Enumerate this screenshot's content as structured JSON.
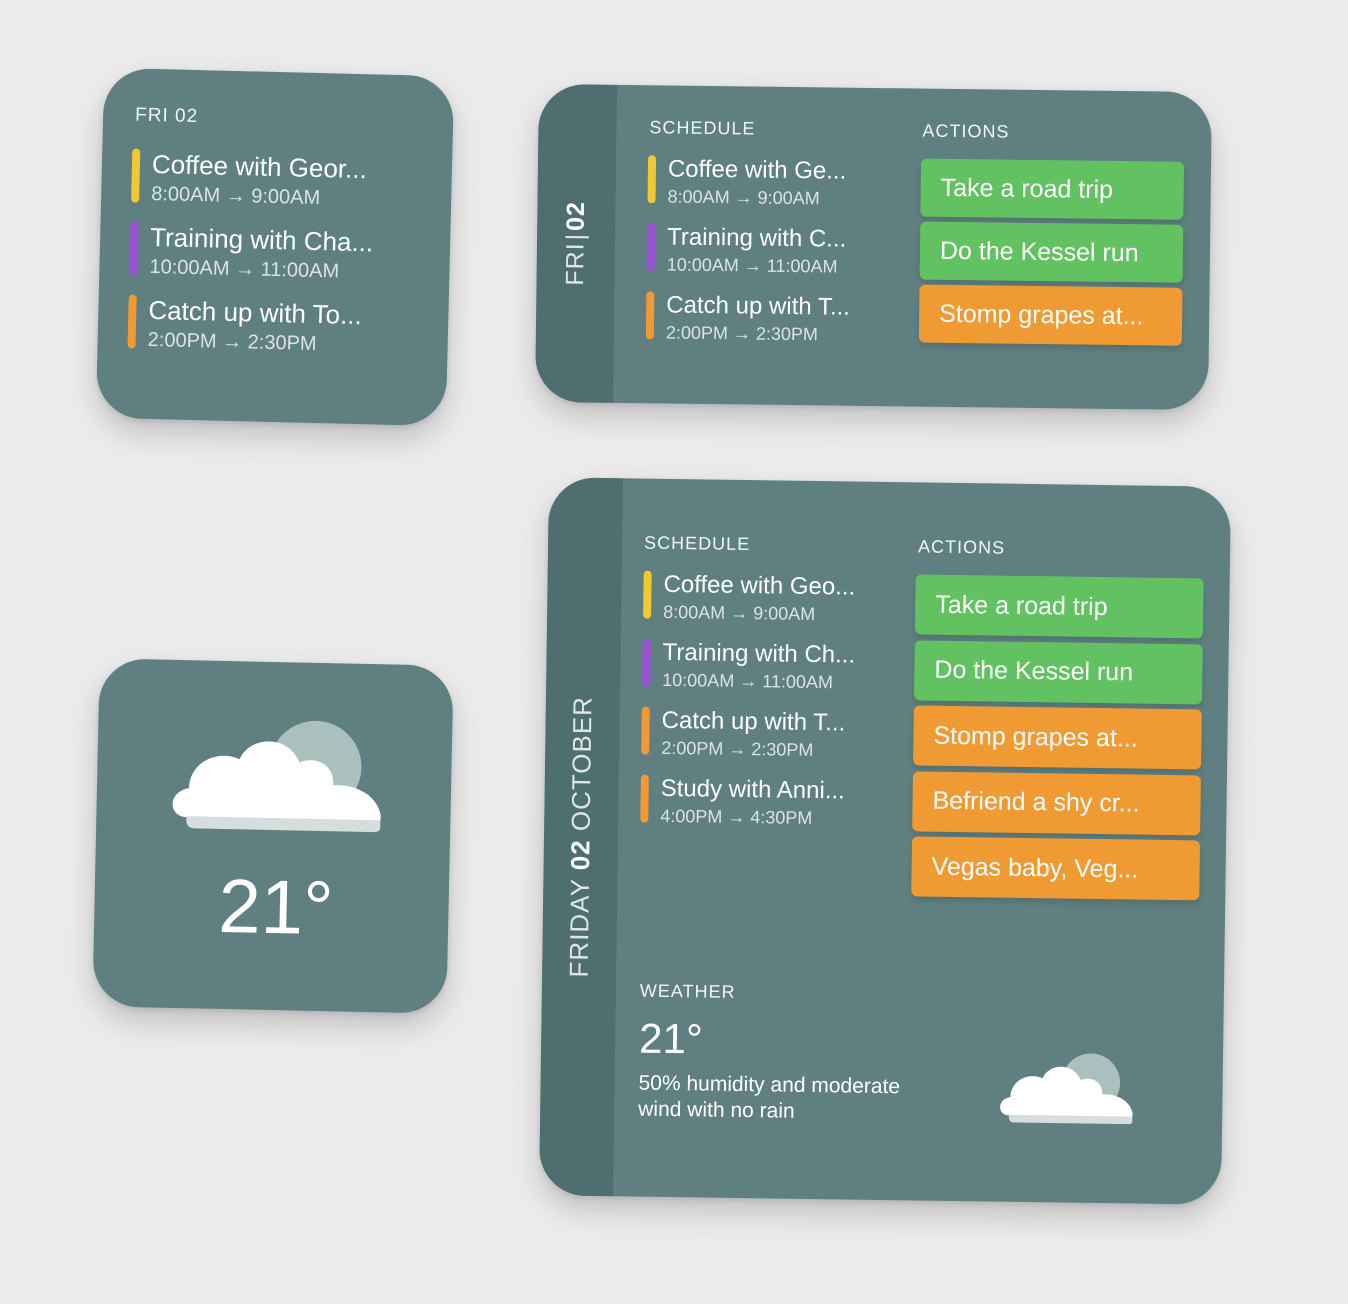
{
  "colors": {
    "widget_bg": "#5f7f80",
    "strip_bg": "#4f6e6f",
    "yellow": "#f2c832",
    "purple": "#9a4fd6",
    "orange": "#f09a34",
    "green": "#62c262"
  },
  "small": {
    "date": "FRI 02",
    "events": [
      {
        "title": "Coffee with Geor...",
        "time": "8:00AM → 9:00AM",
        "color": "#f2c832"
      },
      {
        "title": "Training with Cha...",
        "time": "10:00AM → 11:00AM",
        "color": "#9a4fd6"
      },
      {
        "title": "Catch up with To...",
        "time": "2:00PM → 2:30PM",
        "color": "#f09a34"
      }
    ]
  },
  "medium": {
    "strip_day": "FRI",
    "strip_num": "02",
    "schedule_header": "SCHEDULE",
    "actions_header": "ACTIONS",
    "events": [
      {
        "title": "Coffee with Ge...",
        "time": "8:00AM → 9:00AM",
        "color": "#f2c832"
      },
      {
        "title": "Training with C...",
        "time": "10:00AM → 11:00AM",
        "color": "#9a4fd6"
      },
      {
        "title": "Catch up with T...",
        "time": "2:00PM → 2:30PM",
        "color": "#f09a34"
      }
    ],
    "actions": [
      {
        "label": "Take a road trip",
        "color": "#62c262"
      },
      {
        "label": "Do the Kessel run",
        "color": "#62c262"
      },
      {
        "label": "Stomp grapes at...",
        "color": "#f09a34"
      }
    ]
  },
  "weather_small": {
    "icon": "partly-cloudy-icon",
    "temp": "21°"
  },
  "large": {
    "strip_day": "FRIDAY",
    "strip_num": "02",
    "strip_month": "OCTOBER",
    "schedule_header": "SCHEDULE",
    "actions_header": "ACTIONS",
    "events": [
      {
        "title": "Coffee with Geo...",
        "time": "8:00AM → 9:00AM",
        "color": "#f2c832"
      },
      {
        "title": "Training with Ch...",
        "time": "10:00AM → 11:00AM",
        "color": "#9a4fd6"
      },
      {
        "title": "Catch up with T...",
        "time": "2:00PM → 2:30PM",
        "color": "#f09a34"
      },
      {
        "title": "Study with Anni...",
        "time": "4:00PM → 4:30PM",
        "color": "#f09a34"
      }
    ],
    "actions": [
      {
        "label": "Take a road trip",
        "color": "#62c262"
      },
      {
        "label": "Do the Kessel run",
        "color": "#62c262"
      },
      {
        "label": "Stomp grapes at...",
        "color": "#f09a34"
      },
      {
        "label": "Befriend a shy cr...",
        "color": "#f09a34"
      },
      {
        "label": "Vegas baby, Veg...",
        "color": "#f09a34"
      }
    ],
    "weather_header": "WEATHER",
    "weather_temp": "21°",
    "weather_desc": "50% humidity and moderate wind with no rain",
    "weather_icon": "partly-cloudy-icon"
  }
}
